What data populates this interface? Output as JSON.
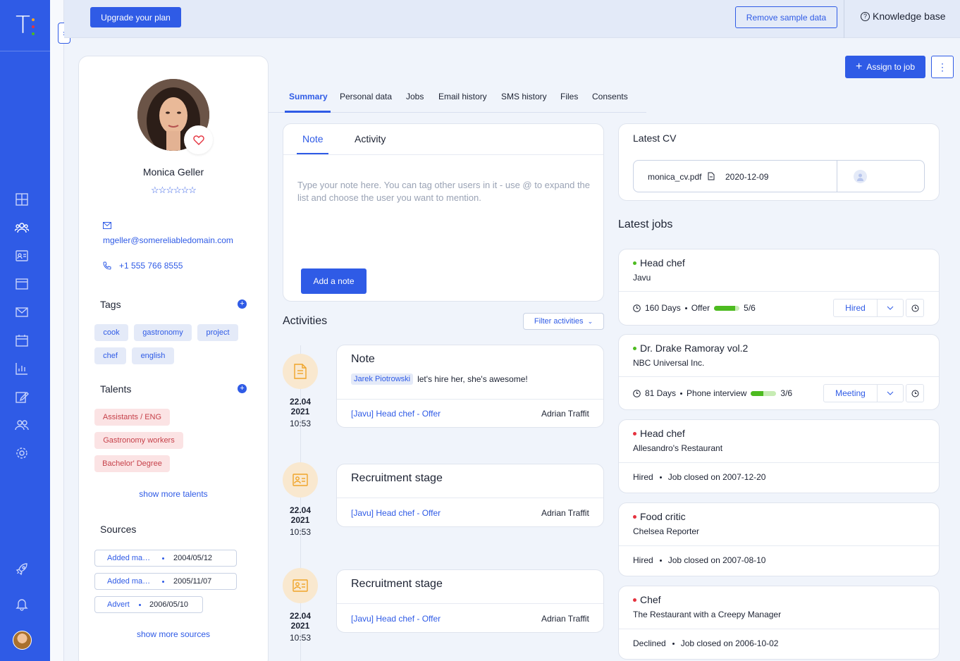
{
  "app": {
    "logo_letter": "T:"
  },
  "topbar": {
    "upgrade_label": "Upgrade your plan",
    "remove_sample_label": "Remove sample data",
    "knowledge_base_label": "Knowledge base"
  },
  "candidate": {
    "name": "Monica Geller",
    "rating": "☆☆☆☆☆☆",
    "email": "mgeller@somereliabledomain.com",
    "phone": "+1 555 766 8555"
  },
  "tags": {
    "title": "Tags",
    "items": [
      "cook",
      "gastronomy",
      "project",
      "chef",
      "english"
    ]
  },
  "talents": {
    "title": "Talents",
    "items": [
      "Assistants / ENG",
      "Gastronomy workers",
      "Bachelor' Degree"
    ],
    "show_more": "show more talents"
  },
  "sources": {
    "title": "Sources",
    "items": [
      {
        "name": "Added manually",
        "date": "2004/05/12"
      },
      {
        "name": "Added manually",
        "date": "2005/11/07"
      },
      {
        "name": "Advert",
        "date": "2006/05/10"
      }
    ],
    "show_more": "show more sources"
  },
  "actions": {
    "assign_label": "Assign to job"
  },
  "tabs": [
    "Summary",
    "Personal data",
    "Jobs",
    "Email history",
    "SMS history",
    "Files",
    "Consents"
  ],
  "note": {
    "tabs": [
      "Note",
      "Activity"
    ],
    "placeholder": "Type your note here. You can tag other users in it - use @ to expand the list and choose the user you want to mention.",
    "add_label": "Add a note"
  },
  "activities": {
    "title": "Activities",
    "filter_label": "Filter activities",
    "items": [
      {
        "title": "Note",
        "mention": "Jarek Piotrowski",
        "text": "let's hire her, she's awesome!",
        "date": "22.04",
        "year": "2021",
        "time": "10:53",
        "link": "[Javu] Head chef - Offer",
        "author": "Adrian Traffit",
        "icon": "document-icon"
      },
      {
        "title": "Recruitment stage",
        "date": "22.04",
        "year": "2021",
        "time": "10:53",
        "link": "[Javu] Head chef - Offer",
        "author": "Adrian Traffit",
        "icon": "id-card-icon"
      },
      {
        "title": "Recruitment stage",
        "date": "22.04",
        "year": "2021",
        "time": "10:53",
        "link": "[Javu] Head chef - Offer",
        "author": "Adrian Traffit",
        "icon": "id-card-icon"
      }
    ]
  },
  "cv": {
    "title": "Latest CV",
    "file": "monica_cv.pdf",
    "date": "2020-12-09"
  },
  "jobs": {
    "title": "Latest jobs",
    "items": [
      {
        "title": "Head chef",
        "company": "Javu",
        "days": "160 Days",
        "stage": "Offer",
        "progress": 0.83,
        "count": "5/6",
        "status": "Hired",
        "status_color": "#4dbb20"
      },
      {
        "title": "Dr. Drake Ramoray vol.2",
        "company": "NBC Universal Inc.",
        "days": "81 Days",
        "stage": "Phone interview",
        "progress": 0.5,
        "count": "3/6",
        "status": "Meeting",
        "status_color": "#4dbb20"
      },
      {
        "title": "Head chef",
        "company": "Allesandro's Restaurant",
        "state": "Hired",
        "closed": "Job closed on 2007-12-20",
        "status_color": "#e5323e"
      },
      {
        "title": "Food critic",
        "company": "Chelsea Reporter",
        "state": "Hired",
        "closed": "Job closed on 2007-08-10",
        "status_color": "#e5323e"
      },
      {
        "title": "Chef",
        "company": "The Restaurant with a Creepy Manager",
        "state": "Declined",
        "closed": "Job closed on 2006-10-02",
        "status_color": "#e5323e"
      }
    ]
  }
}
